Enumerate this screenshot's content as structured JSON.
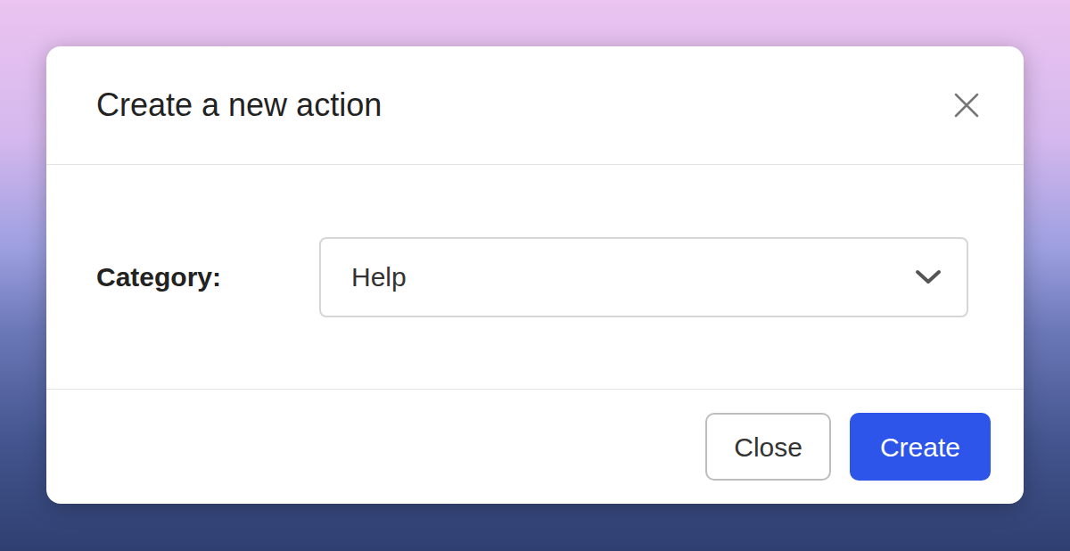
{
  "dialog": {
    "title": "Create a new action",
    "fields": [
      {
        "label": "Category:",
        "value": "Help"
      }
    ],
    "buttons": [
      {
        "label": "Close",
        "kind": "secondary"
      },
      {
        "label": "Create",
        "kind": "primary"
      }
    ]
  }
}
